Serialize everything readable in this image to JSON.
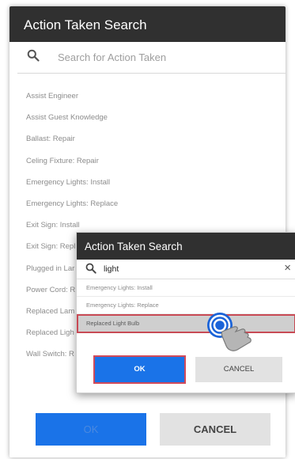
{
  "back_dialog": {
    "title": "Action Taken Search",
    "search_placeholder": "Search for Action Taken",
    "items": [
      "Assist Engineer",
      "Assist Guest Knowledge",
      "Ballast: Repair",
      "Celing Fixture: Repair",
      "Emergency Lights: Install",
      "Emergency Lights: Replace",
      "Exit Sign: Install",
      "Exit Sign: Repl",
      "Plugged in Lar",
      "Power Cord: R",
      "Replaced Lam",
      "Replaced Ligh",
      "Wall Switch: R"
    ],
    "ok_label": "OK",
    "cancel_label": "CANCEL"
  },
  "front_dialog": {
    "title": "Action Taken Search",
    "search_value": "light",
    "close_glyph": "×",
    "items": [
      {
        "label": "Emergency Lights: Install",
        "selected": false
      },
      {
        "label": "Emergency Lights: Replace",
        "selected": false
      },
      {
        "label": "Replaced Light Bulb",
        "selected": true
      }
    ],
    "ok_label": "OK",
    "cancel_label": "CANCEL"
  },
  "icons": {
    "search": "search-icon",
    "close": "close-icon",
    "tap": "tap-gesture-icon"
  },
  "colors": {
    "header_bg": "#303030",
    "primary_blue": "#1a73e8",
    "highlight_red": "#c84a55"
  }
}
